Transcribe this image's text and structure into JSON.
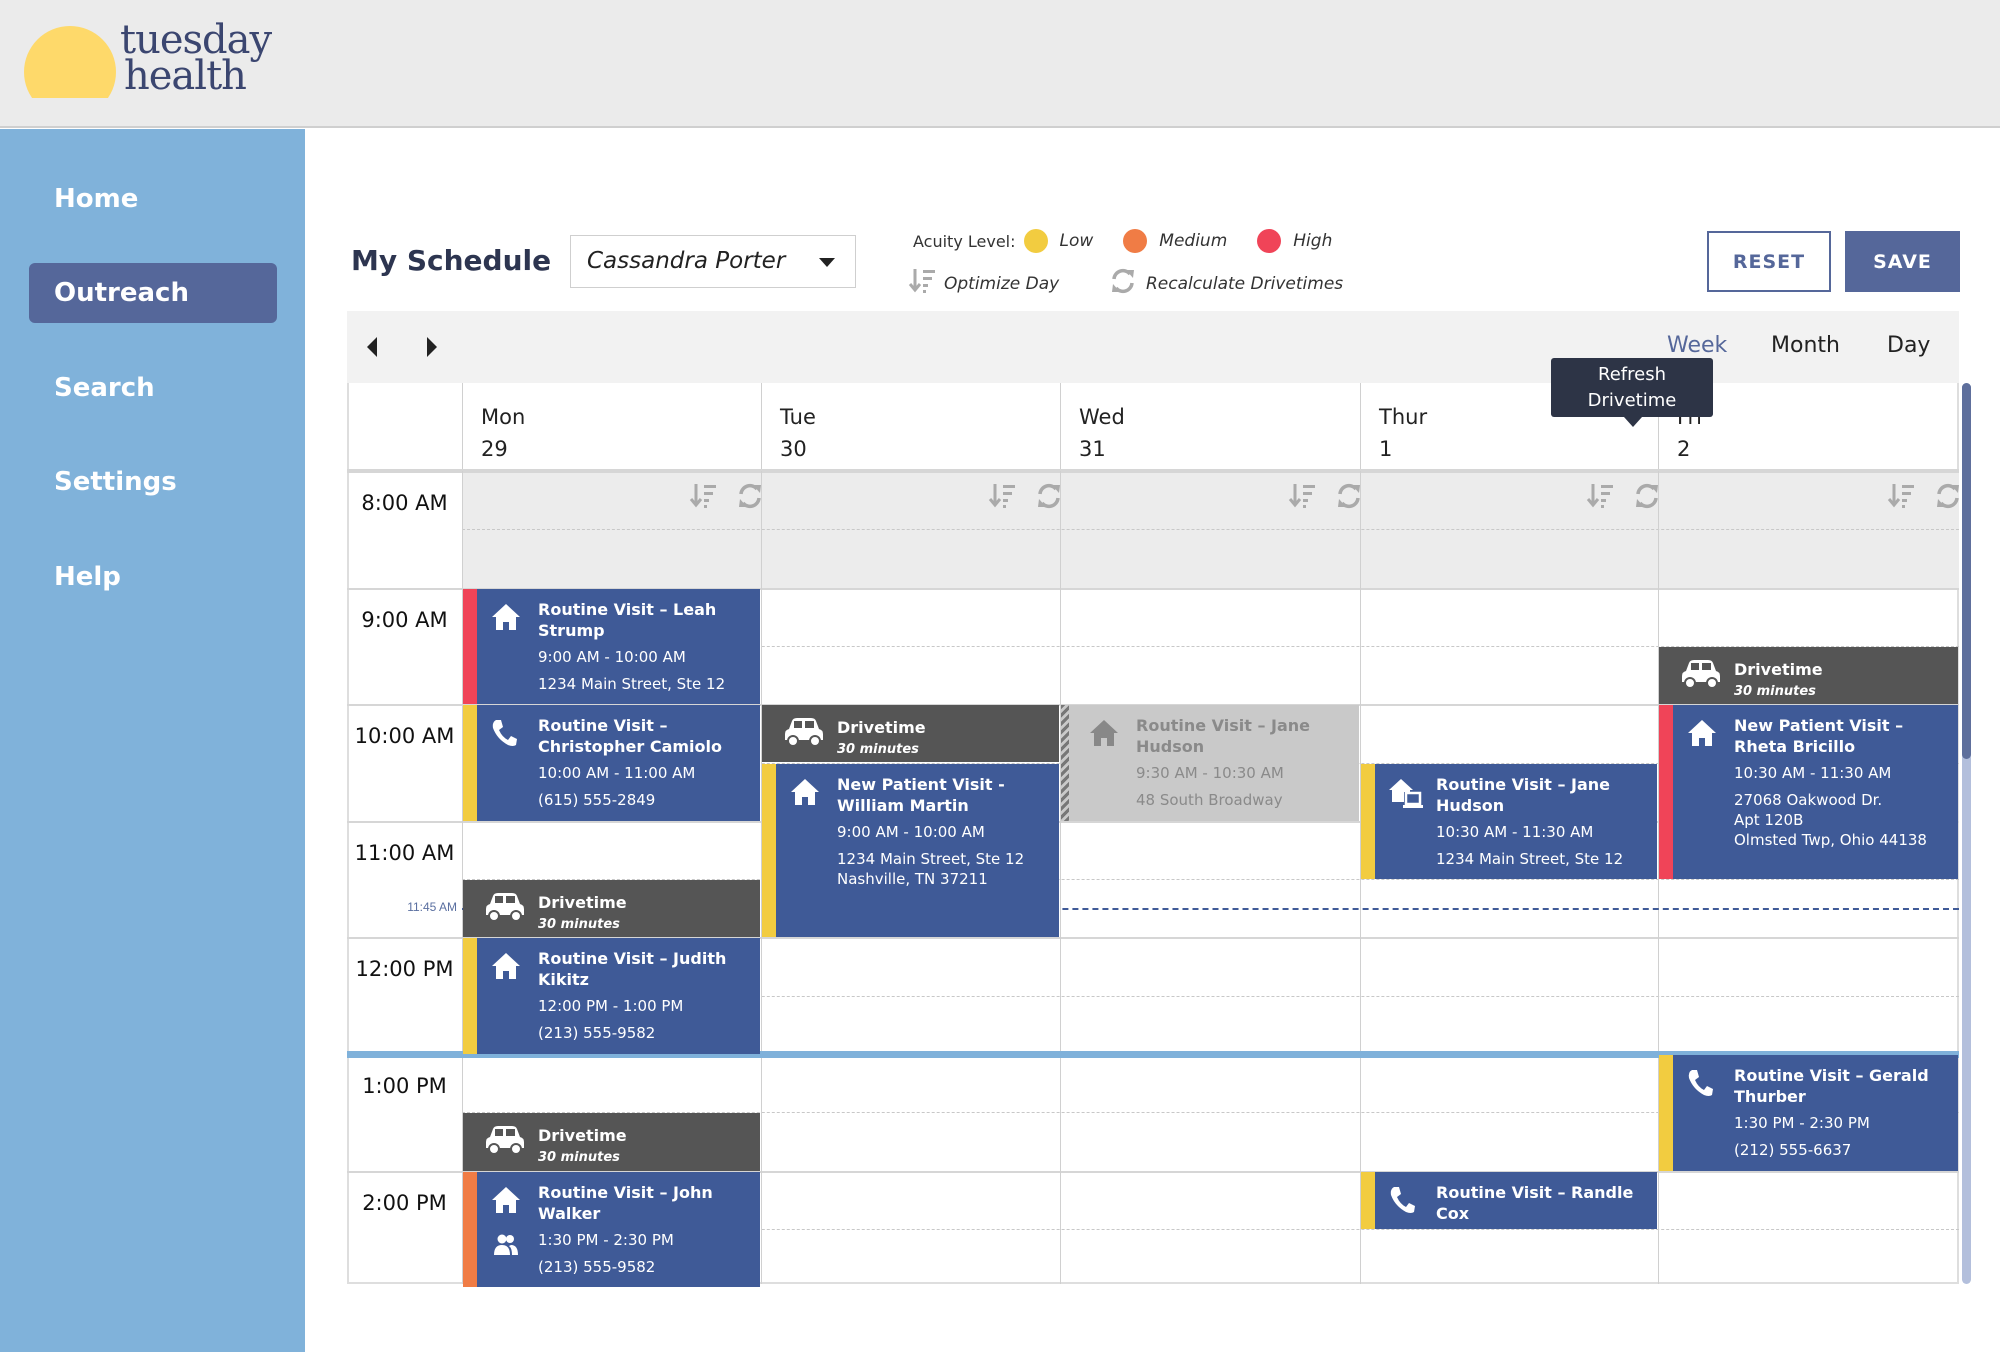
{
  "brand": {
    "line1": "tuesday",
    "line2": "health",
    "sun_color": "#fed96a"
  },
  "sidebar": {
    "items": [
      {
        "label": "Home"
      },
      {
        "label": "Outreach",
        "active": true
      },
      {
        "label": "Search"
      },
      {
        "label": "Settings"
      },
      {
        "label": "Help"
      }
    ]
  },
  "header": {
    "title": "My Schedule",
    "provider": "Cassandra Porter",
    "acuity_label": "Acuity Level:",
    "acuity": [
      {
        "label": "Low",
        "color": "#f2cc40"
      },
      {
        "label": "Medium",
        "color": "#f07c45"
      },
      {
        "label": "High",
        "color": "#f04458"
      }
    ],
    "optimize": "Optimize Day",
    "recalc": "Recalculate Drivetimes",
    "reset": "RESET",
    "save": "SAVE"
  },
  "calendar": {
    "views": [
      {
        "label": "Week",
        "active": true
      },
      {
        "label": "Month"
      },
      {
        "label": "Day"
      }
    ],
    "tooltip": "Refresh Drivetime",
    "days": [
      {
        "name": "Mon",
        "num": "29"
      },
      {
        "name": "Tue",
        "num": "30"
      },
      {
        "name": "Wed",
        "num": "31"
      },
      {
        "name": "Thur",
        "num": "1"
      },
      {
        "name": "Fri",
        "num": "2"
      }
    ],
    "hours": [
      "8:00 AM",
      "9:00 AM",
      "10:00 AM",
      "11:00 AM",
      "12:00 PM",
      "1:00 PM",
      "2:00 PM"
    ],
    "now_label": "11:45 AM",
    "now_time": 11.75,
    "events": [
      {
        "day": 0,
        "start": 9,
        "end": 10,
        "type": "visit",
        "acuity": "High",
        "icon": "house",
        "title": "Routine Visit – Leah Strump",
        "lines": [
          "9:00 AM - 10:00 AM",
          "1234 Main Street, Ste 12"
        ]
      },
      {
        "day": 0,
        "start": 10,
        "end": 11,
        "type": "visit",
        "acuity": "Low",
        "icon": "phone",
        "title": "Routine Visit – Christopher Camiolo",
        "lines": [
          "10:00 AM - 11:00 AM",
          "(615) 555-2849"
        ]
      },
      {
        "day": 0,
        "start": 11.5,
        "end": 12,
        "type": "drive",
        "icon": "car",
        "title": "Drivetime",
        "lines": [
          "30 minutes"
        ]
      },
      {
        "day": 0,
        "start": 12,
        "end": 13,
        "type": "visit",
        "acuity": "Low",
        "icon": "house",
        "title": "Routine Visit – Judith Kikitz",
        "lines": [
          "12:00 PM - 1:00 PM",
          "(213) 555-9582"
        ]
      },
      {
        "day": 0,
        "start": 13.5,
        "end": 14,
        "type": "drive",
        "icon": "car",
        "title": "Drivetime",
        "lines": [
          "30 minutes"
        ]
      },
      {
        "day": 0,
        "start": 14,
        "end": 15,
        "type": "visit",
        "acuity": "Medium",
        "icon": "house",
        "extra_icon": "people",
        "title": "Routine Visit – John Walker",
        "lines": [
          "1:30 PM - 2:30 PM",
          "(213) 555-9582"
        ]
      },
      {
        "day": 1,
        "start": 10,
        "end": 10.5,
        "type": "drive",
        "icon": "car",
        "title": "Drivetime",
        "lines": [
          "30 minutes"
        ]
      },
      {
        "day": 1,
        "start": 10.5,
        "end": 12,
        "type": "visit",
        "acuity": "Low",
        "icon": "house",
        "title": "New Patient Visit - William Martin",
        "lines": [
          "9:00 AM - 10:00 AM",
          "1234 Main Street, Ste 12",
          "Nashville, TN 37211"
        ]
      },
      {
        "day": 2,
        "start": 10,
        "end": 11,
        "type": "ghost",
        "icon": "house",
        "title": "Routine Visit – Jane Hudson",
        "lines": [
          "9:30 AM - 10:30 AM",
          "48 South Broadway"
        ]
      },
      {
        "day": 3,
        "start": 10.5,
        "end": 11.5,
        "type": "visit",
        "acuity": "Low",
        "icon": "house-laptop",
        "title": "Routine Visit – Jane Hudson",
        "lines": [
          "10:30 AM - 11:30 AM",
          "1234 Main Street, Ste 12"
        ]
      },
      {
        "day": 3,
        "start": 14,
        "end": 14.5,
        "type": "visit",
        "acuity": "Low",
        "icon": "phone",
        "title": "Routine Visit – Randle Cox",
        "lines": []
      },
      {
        "day": 4,
        "start": 9.5,
        "end": 10,
        "type": "drive",
        "icon": "car",
        "title": "Drivetime",
        "lines": [
          "30 minutes"
        ]
      },
      {
        "day": 4,
        "start": 10,
        "end": 11.5,
        "type": "visit",
        "acuity": "High",
        "icon": "house",
        "title": "New Patient Visit – Rheta Bricillo",
        "lines": [
          "10:30 AM - 11:30 AM",
          "27068 Oakwood Dr.",
          "Apt 120B",
          "Olmsted Twp, Ohio 44138"
        ]
      },
      {
        "day": 4,
        "start": 13,
        "end": 14,
        "type": "visit",
        "acuity": "Low",
        "icon": "phone",
        "title": "Routine Visit – Gerald Thurber",
        "lines": [
          "1:30 PM - 2:30 PM",
          "(212) 555-6637"
        ]
      }
    ]
  },
  "colors": {
    "event": "#3f5a97",
    "drive": "#555555",
    "ghost": "#c9c9c9",
    "accent": "#55679a"
  }
}
